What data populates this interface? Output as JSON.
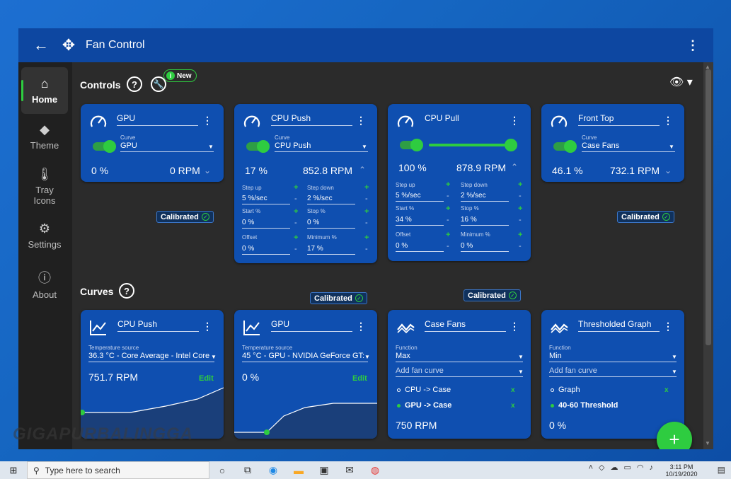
{
  "window": {
    "title": "Fan Control"
  },
  "nav": [
    {
      "label": "Home",
      "icon": "home-icon",
      "glyph": "⌂"
    },
    {
      "label": "Theme",
      "icon": "paint-bucket-icon",
      "glyph": "◆"
    },
    {
      "label": "Tray\nIcons",
      "icon": "thermometer-icon",
      "glyph": "🌡"
    },
    {
      "label": "Settings",
      "icon": "gear-icon",
      "glyph": "⚙"
    },
    {
      "label": "About",
      "icon": "info-icon",
      "glyph": "ⓘ"
    }
  ],
  "controls_section": {
    "title": "Controls",
    "new_label": "New"
  },
  "curves_section": {
    "title": "Curves"
  },
  "controls": [
    {
      "name": "GPU",
      "curve_label": "Curve",
      "curve": "GPU",
      "percent": "0 %",
      "rpm": "0 RPM",
      "calibrated": "Calibrated",
      "expanded": false
    },
    {
      "name": "CPU Push",
      "curve_label": "Curve",
      "curve": "CPU Push",
      "percent": "17 %",
      "rpm": "852.8 RPM",
      "calibrated": "Calibrated",
      "expanded": true,
      "params": [
        {
          "label": "Step up",
          "value": "5 %/sec"
        },
        {
          "label": "Step down",
          "value": "2 %/sec"
        },
        {
          "label": "Start %",
          "value": "0 %"
        },
        {
          "label": "Stop %",
          "value": "0 %"
        },
        {
          "label": "Offset",
          "value": "0 %"
        },
        {
          "label": "Minimum %",
          "value": "17 %"
        }
      ]
    },
    {
      "name": "CPU Pull",
      "percent": "100 %",
      "rpm": "878.9 RPM",
      "calibrated": "Calibrated",
      "expanded": true,
      "slider_value": 100,
      "params": [
        {
          "label": "Step up",
          "value": "5 %/sec"
        },
        {
          "label": "Step down",
          "value": "2 %/sec"
        },
        {
          "label": "Start %",
          "value": "34 %"
        },
        {
          "label": "Stop %",
          "value": "16 %"
        },
        {
          "label": "Offset",
          "value": "0 %"
        },
        {
          "label": "Minimum %",
          "value": "0 %"
        }
      ]
    },
    {
      "name": "Front Top",
      "curve_label": "Curve",
      "curve": "Case Fans",
      "percent": "46.1 %",
      "rpm": "732.1 RPM",
      "calibrated": "Calibrated",
      "expanded": false
    }
  ],
  "curves": [
    {
      "name": "CPU Push",
      "source_label": "Temperature source",
      "source": "36.3 °C - Core Average - Intel Core",
      "value": "751.7 RPM",
      "edit": "Edit"
    },
    {
      "name": "GPU",
      "source_label": "Temperature source",
      "source": "45 °C - GPU - NVIDIA GeForce GT:",
      "value": "0 %",
      "edit": "Edit"
    },
    {
      "name": "Case Fans",
      "function_label": "Function",
      "function": "Max",
      "add_label": "Add fan curve",
      "items": [
        {
          "label": "CPU -> Case",
          "active": false
        },
        {
          "label": "GPU -> Case",
          "active": true
        }
      ],
      "value": "750 RPM",
      "remove": "x"
    },
    {
      "name": "Thresholded Graph",
      "function_label": "Function",
      "function": "Min",
      "add_label": "Add fan curve",
      "items": [
        {
          "label": "Graph",
          "active": false
        },
        {
          "label": "40-60 Threshold",
          "active": true
        }
      ],
      "value": "0 %",
      "remove": "x"
    }
  ],
  "fab": {
    "label": "+"
  },
  "taskbar": {
    "search_placeholder": "Type here to search",
    "time": "3:11 PM",
    "date": "10/19/2020"
  },
  "watermark": "GIGAPURBALINGGA",
  "colors": {
    "card": "#0f4fb0",
    "accent": "#2ecc40",
    "titlebar": "#0d47a1",
    "background": "#2b2b2b"
  }
}
